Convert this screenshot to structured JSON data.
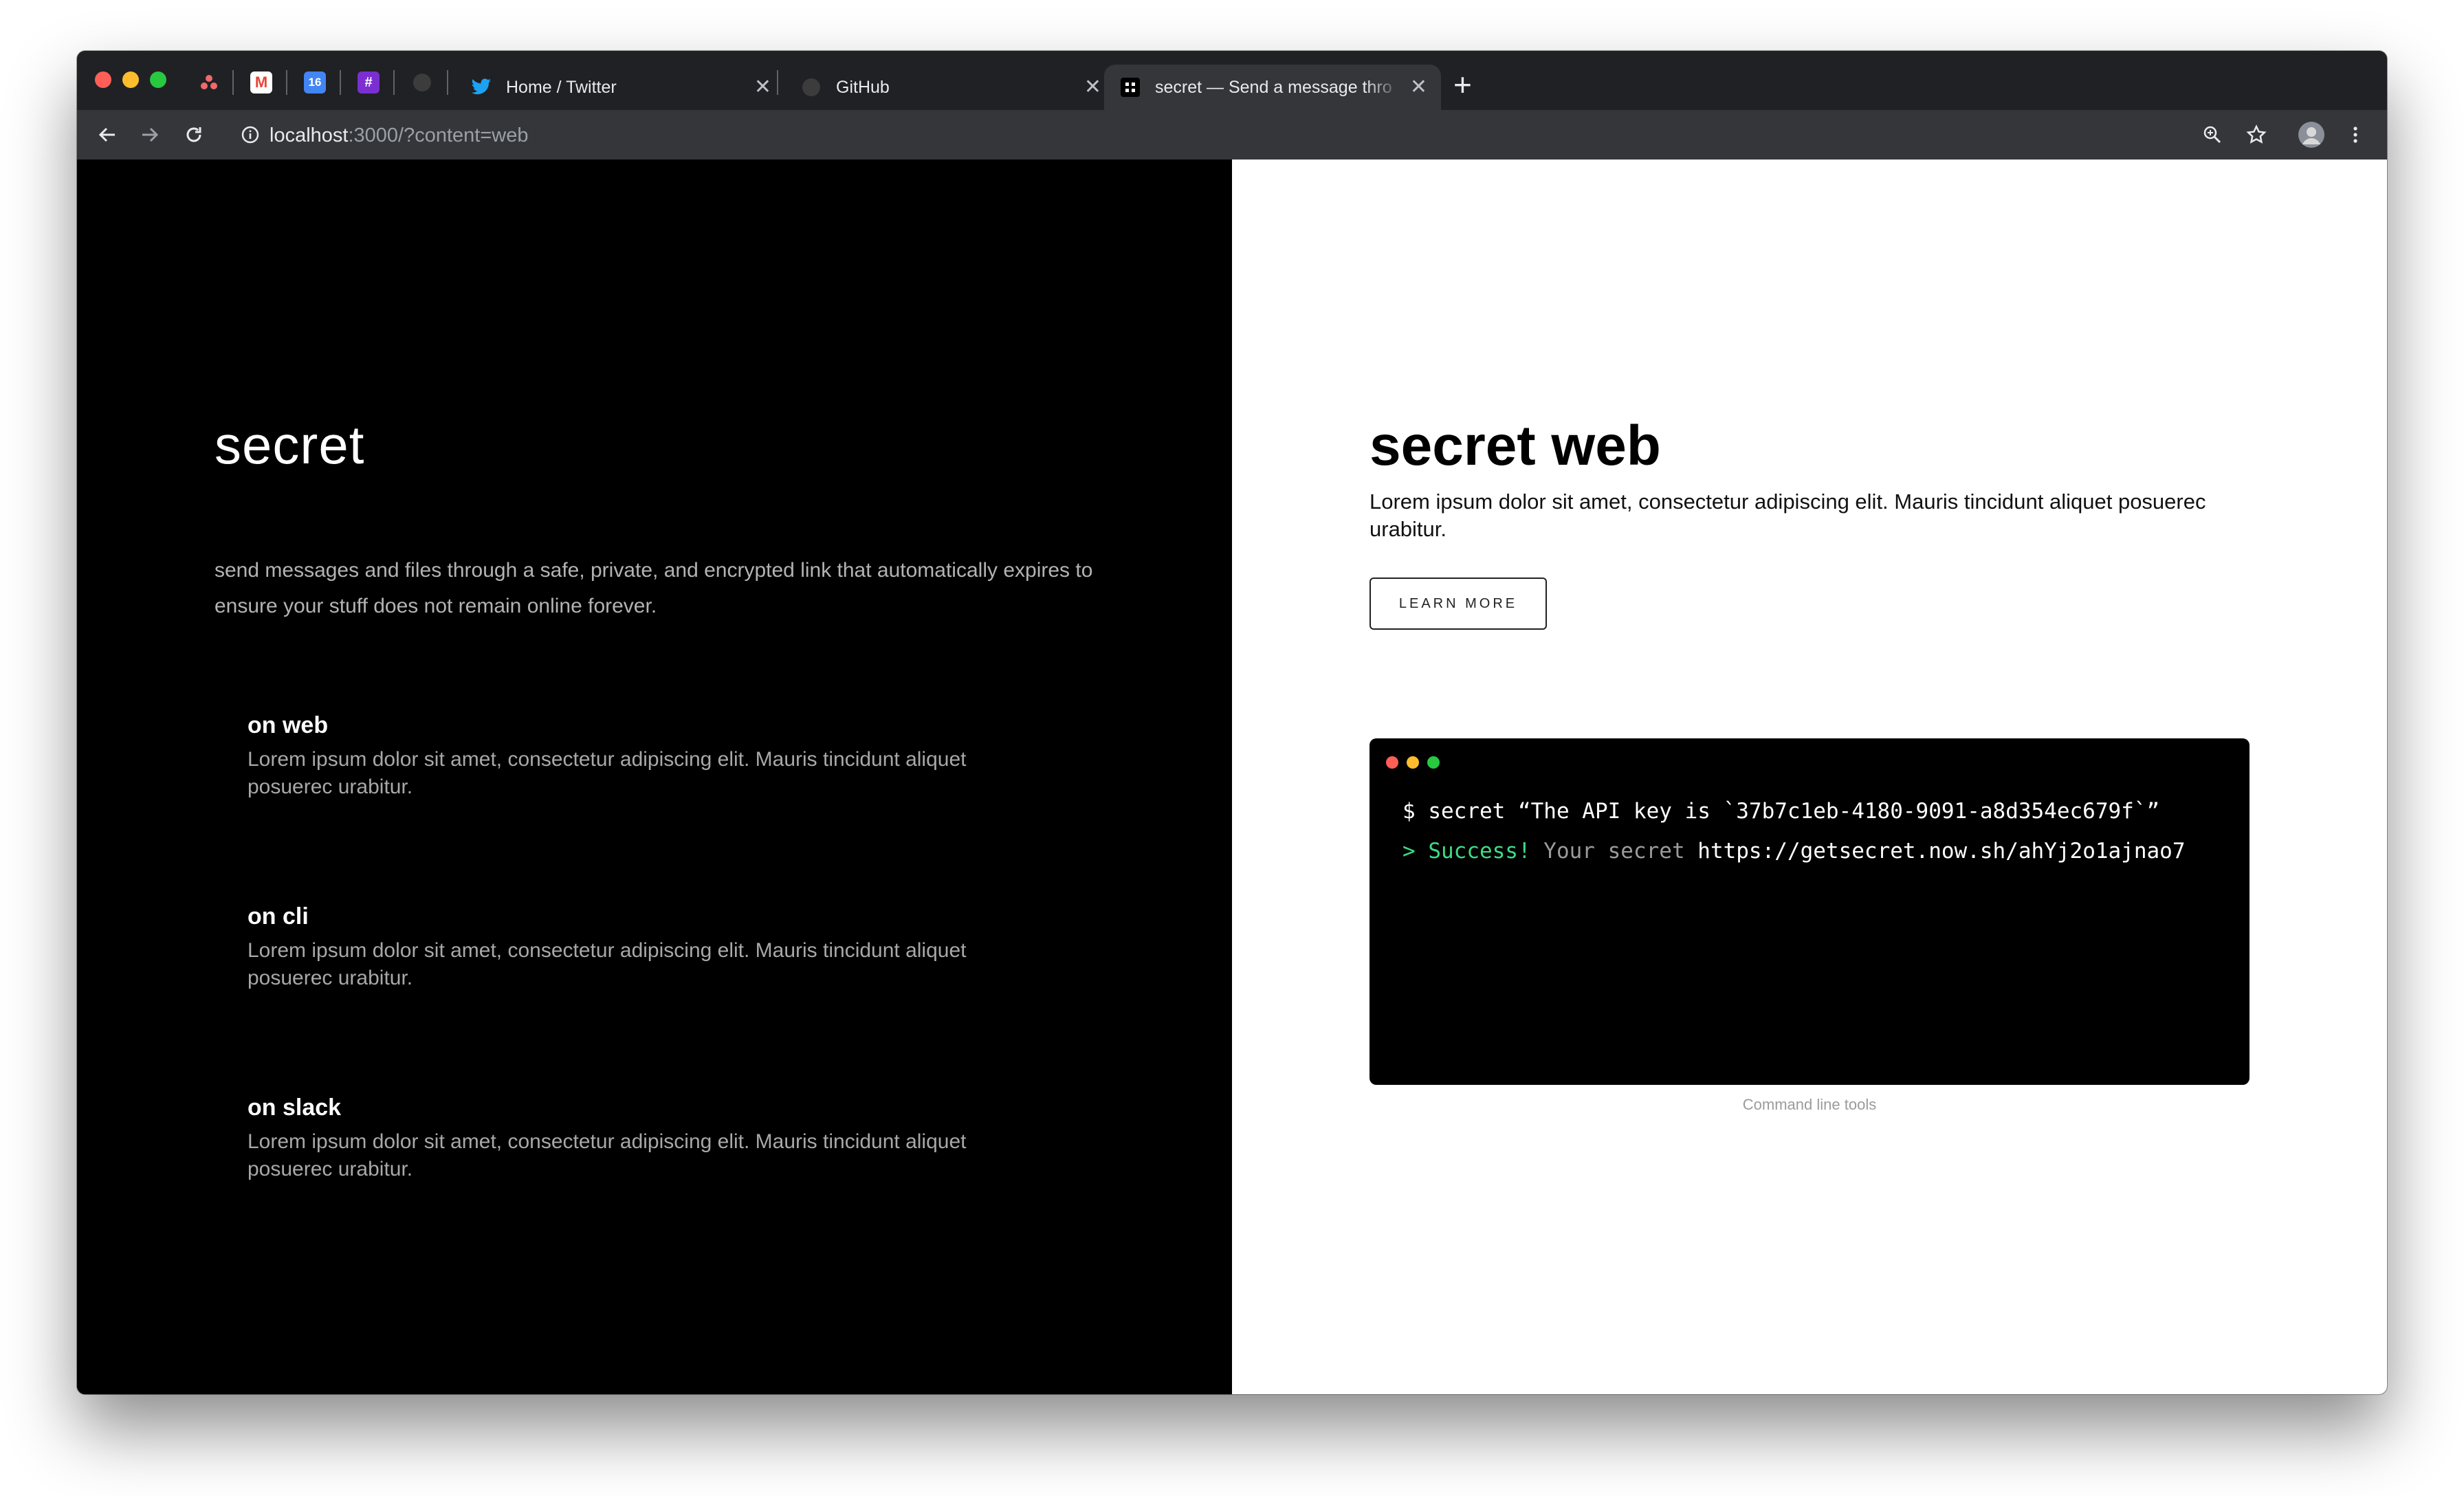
{
  "browser": {
    "traffic_lights": {
      "close": "#ff5f57",
      "minimize": "#febc2e",
      "zoom": "#28c840"
    },
    "pinned_tabs": [
      {
        "name": "asana-favicon",
        "glyph": "●",
        "color": "#f06a6a"
      },
      {
        "name": "gmail-favicon",
        "glyph": "M",
        "color": "#ea4335"
      },
      {
        "name": "calendar-favicon",
        "glyph": "16",
        "color": "#4285f4"
      },
      {
        "name": "app-favicon",
        "glyph": "#",
        "color": "#7b2fd1"
      },
      {
        "name": "github-favicon",
        "glyph": "●",
        "color": "#555555"
      }
    ],
    "tabs": [
      {
        "title": "Home / Twitter",
        "close": "✕"
      },
      {
        "title": "GitHub",
        "close": "✕"
      },
      {
        "title": "secret — Send a message thro",
        "close": "✕"
      }
    ],
    "new_tab": "+",
    "url": {
      "host": "localhost",
      "rest": ":3000/?content=web"
    }
  },
  "left": {
    "brand": "secret",
    "tagline": "send messages and files through a safe, private, and encrypted link that automatically expires to ensure your stuff does not remain online forever.",
    "features": [
      {
        "title": "on web",
        "desc": "Lorem ipsum dolor sit amet, consectetur adipiscing elit. Mauris tincidunt aliquet posuerec urabitur."
      },
      {
        "title": "on cli",
        "desc": "Lorem ipsum dolor sit amet, consectetur adipiscing elit. Mauris tincidunt aliquet posuerec urabitur."
      },
      {
        "title": "on slack",
        "desc": "Lorem ipsum dolor sit amet, consectetur adipiscing elit. Mauris tincidunt aliquet posuerec urabitur."
      }
    ]
  },
  "right": {
    "title": "secret web",
    "desc": "Lorem ipsum dolor sit amet, consectetur adipiscing elit. Mauris tincidunt aliquet posuerec urabitur.",
    "button": "LEARN MORE",
    "terminal": {
      "line1": "$ secret “The API key is `37b7c1eb-4180-9091-a8d354ec679f`”",
      "line2_prompt": "> Success!",
      "line2_mid": " Your secret ",
      "line2_link": "https://getsecret.now.sh/ahYj2o1ajnao7"
    },
    "caption": "Command line tools"
  },
  "colors": {
    "success": "#3ddc84",
    "muted": "#9b9b9b"
  }
}
